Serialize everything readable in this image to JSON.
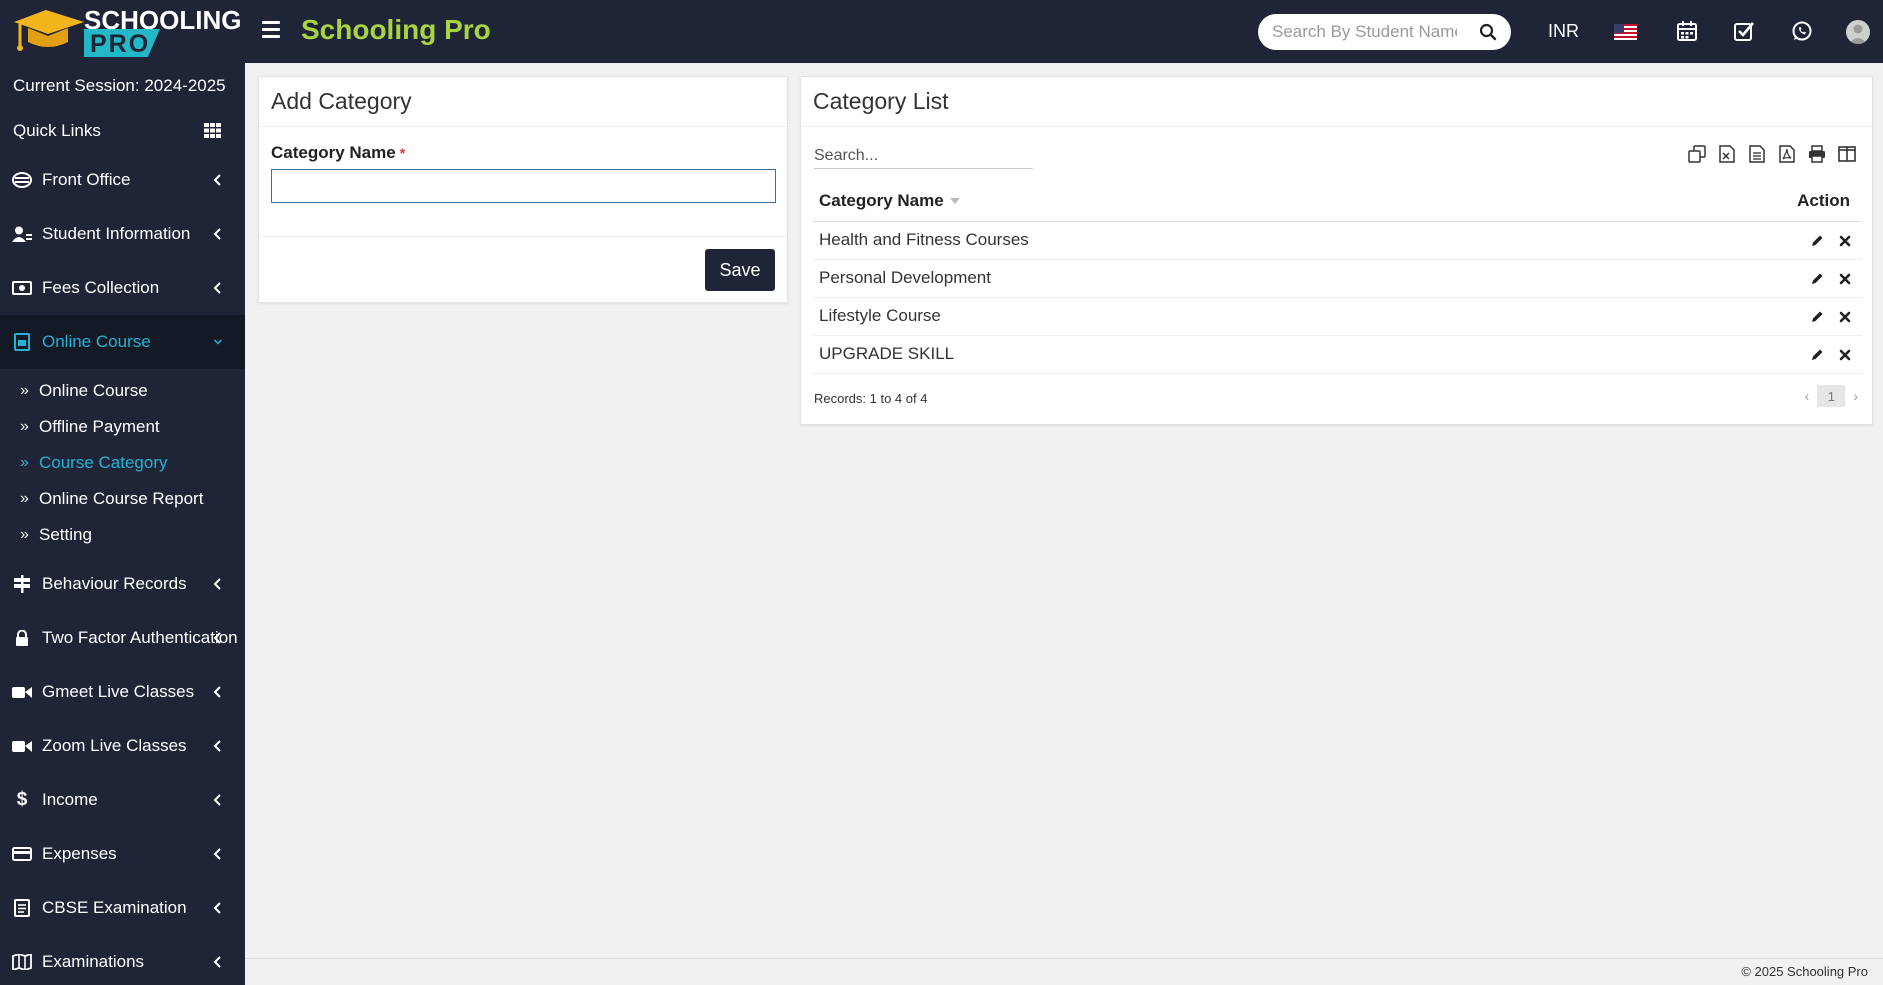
{
  "header": {
    "logo_text": "SCHOOLING",
    "logo_pro": "PRO",
    "brand": "Schooling Pro",
    "search_placeholder": "Search By Student Name",
    "currency": "INR"
  },
  "sidebar": {
    "session": "Current Session: 2024-2025",
    "quick_links": "Quick Links",
    "menu_top": [
      {
        "label": "Front Office",
        "icon": "front-office-icon"
      },
      {
        "label": "Student Information",
        "icon": "user-icon"
      },
      {
        "label": "Fees Collection",
        "icon": "money-icon"
      },
      {
        "label": "Online Course",
        "icon": "course-icon"
      }
    ],
    "submenu": [
      {
        "label": "Online Course"
      },
      {
        "label": "Offline Payment"
      },
      {
        "label": "Course Category"
      },
      {
        "label": "Online Course Report"
      },
      {
        "label": "Setting"
      }
    ],
    "menu_bottom": [
      {
        "label": "Behaviour Records",
        "icon": "signpost-icon"
      },
      {
        "label": "Two Factor Authentication",
        "icon": "lock-icon"
      },
      {
        "label": "Gmeet Live Classes",
        "icon": "video-icon"
      },
      {
        "label": "Zoom Live Classes",
        "icon": "video-icon"
      },
      {
        "label": "Income",
        "icon": "dollar-icon"
      },
      {
        "label": "Expenses",
        "icon": "credit-card-icon"
      },
      {
        "label": "CBSE Examination",
        "icon": "document-icon"
      },
      {
        "label": "Examinations",
        "icon": "map-icon"
      }
    ]
  },
  "add_category": {
    "title": "Add Category",
    "field_label": "Category Name",
    "required_mark": "*",
    "input_value": "",
    "save_label": "Save"
  },
  "category_list": {
    "title": "Category List",
    "search_placeholder": "Search...",
    "columns": {
      "name": "Category Name",
      "action": "Action"
    },
    "rows": [
      {
        "name": "Health and Fitness Courses"
      },
      {
        "name": "Personal Development"
      },
      {
        "name": "Lifestyle Course"
      },
      {
        "name": "UPGRADE SKILL"
      }
    ],
    "records": "Records: 1 to 4 of 4",
    "current_page": "1"
  },
  "footer": {
    "copyright": "© 2025 Schooling Pro"
  },
  "colors": {
    "sidebar_bg": "#1f2536",
    "brand_green": "#a7d43f",
    "active_blue": "#22b2d6"
  }
}
